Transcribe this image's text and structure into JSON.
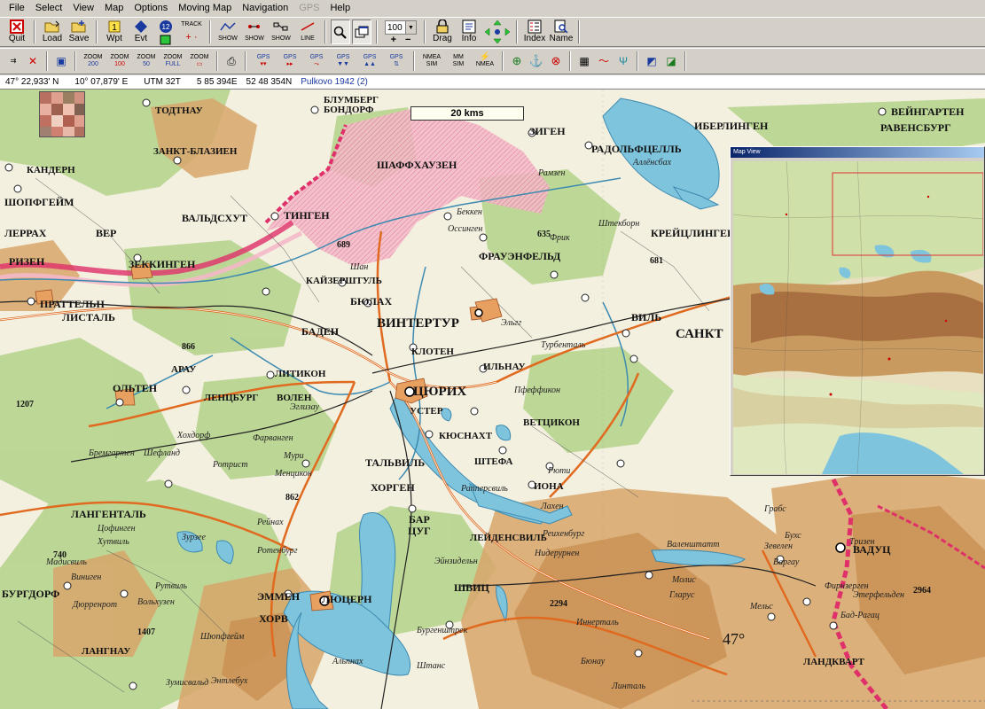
{
  "menu": {
    "items": [
      {
        "label": "File",
        "disabled": false
      },
      {
        "label": "Select",
        "disabled": false
      },
      {
        "label": "View",
        "disabled": false
      },
      {
        "label": "Map",
        "disabled": false
      },
      {
        "label": "Options",
        "disabled": false
      },
      {
        "label": "Moving Map",
        "disabled": false
      },
      {
        "label": "Navigation",
        "disabled": false
      },
      {
        "label": "GPS",
        "disabled": true
      },
      {
        "label": "Help",
        "disabled": false
      }
    ]
  },
  "toolbar": {
    "quit": "Quit",
    "load": "Load",
    "save": "Save",
    "wpt": "Wpt",
    "evt": "Evt",
    "badge": "12",
    "track": "TRACK",
    "show1": "SHOW",
    "show2": "SHOW",
    "show3": "SHOW",
    "line": "LINE",
    "zoom_value": "100",
    "zoom_plus": "+",
    "zoom_minus": "−",
    "drag": "Drag",
    "info": "Info",
    "index": "Index",
    "name": "Name"
  },
  "toolbar2": {
    "zoom200_a": "ZOOM",
    "zoom200_b": "200",
    "zoom100_a": "ZOOM",
    "zoom100_b": "100",
    "zoom50_a": "ZOOM",
    "zoom50_b": "50",
    "zoomfull_a": "ZOOM",
    "zoomfull_b": "FULL",
    "zoomx_a": "ZOOM",
    "gps1": "GPS",
    "gps2": "GPS",
    "gps3": "GPS",
    "gps4": "GPS",
    "gps5": "GPS",
    "gps6": "GPS",
    "nmea_a": "NMEA",
    "nmea_b": "SIM",
    "mm_a": "MM",
    "mm_b": "SIM",
    "nmea2": "NMEA"
  },
  "status": {
    "lat": "47° 22,933' N",
    "lon": "10° 07,879' E",
    "utm": "UTM 32T",
    "easting": "5 85 394E",
    "northing": "52 48 354N",
    "datum": "Pulkovo 1942 (2)"
  },
  "map": {
    "scale_label": "20 kms",
    "labels": [
      {
        "t": "ЗИГЕН"
      },
      {
        "t": "РАДОЛЬФЦЕЛЛЬ"
      },
      {
        "t": "ИБЕРЛИНГЕН"
      },
      {
        "t": "ВЕЙНГАРТЕН"
      },
      {
        "t": "РАВЕНСБУРГ"
      },
      {
        "t": "ШАФФХАУЗЕН"
      },
      {
        "t": "БЛУМБЕРГ"
      },
      {
        "t": "БОНДОРФ"
      },
      {
        "t": "ТОДТНАУ"
      },
      {
        "t": "КАНДЕРН"
      },
      {
        "t": "ШОПФГЕЙМ"
      },
      {
        "t": "ЛЕРРАХ"
      },
      {
        "t": "ВЕР"
      },
      {
        "t": "РИЗЕН"
      },
      {
        "t": "ВАЛЬДСХУТ"
      },
      {
        "t": "ТИНГЕН"
      },
      {
        "t": "ЗЕККИНГЕН"
      },
      {
        "t": "ПРАТТЕЛЬН"
      },
      {
        "t": "ЛИСТАЛЬ"
      },
      {
        "t": "КАЙЗЕРШТУЛЬ"
      },
      {
        "t": "БЮЛАХ"
      },
      {
        "t": "ВИНТЕРТУР"
      },
      {
        "t": "ФРАУЭНФЕЛЬД"
      },
      {
        "t": "ВИЛЬ"
      },
      {
        "t": "САНКТ"
      },
      {
        "t": "БАДЕН"
      },
      {
        "t": "КЛОТЕН"
      },
      {
        "t": "ИЛЬНАУ"
      },
      {
        "t": "ЛИТИКОН"
      },
      {
        "t": "ЛЕНЦБУРГ"
      },
      {
        "t": "ВОЛЕН"
      },
      {
        "t": "ЦЮРИХ"
      },
      {
        "t": "УСТЕР"
      },
      {
        "t": "ВЕТЦИКОН"
      },
      {
        "t": "КЮСНАХТ"
      },
      {
        "t": "ОЛЬТЕН"
      },
      {
        "t": "АРАУ"
      },
      {
        "t": "ТАЛЬВИЛЬ"
      },
      {
        "t": "ХОРГЕН"
      },
      {
        "t": "ШТЕФА"
      },
      {
        "t": "ИОНА"
      },
      {
        "t": "ЛАНГЕНТАЛЬ"
      },
      {
        "t": "БАР"
      },
      {
        "t": "ЦУГ"
      },
      {
        "t": "БУРГДОРФ"
      },
      {
        "t": "ЛЮЦЕРН"
      },
      {
        "t": "ЭММЕН"
      },
      {
        "t": "ХОРВ"
      },
      {
        "t": "ШВИЦ"
      },
      {
        "t": "ВАДУЦ"
      },
      {
        "t": "ЛАНГНАУ"
      },
      {
        "t": "ЛАНДКВАРТ"
      },
      {
        "t": "ЛЕЙДЕНСВИЛЬ"
      },
      {
        "t": "ЗАНКТ-БЛАЗИЕН"
      },
      {
        "t": "КРЕЙЦЛИНГЕН"
      }
    ],
    "small_labels": [
      {
        "t": "Штекборн"
      },
      {
        "t": "Аллёнсбах"
      },
      {
        "t": "Рамзен"
      },
      {
        "t": "Беккен"
      },
      {
        "t": "Оссинген"
      },
      {
        "t": "Фрик"
      },
      {
        "t": "Эльгг"
      },
      {
        "t": "Турбенталь"
      },
      {
        "t": "Пфеффикон"
      },
      {
        "t": "Фарвангeн"
      },
      {
        "t": "Мури"
      },
      {
        "t": "Менцикон"
      },
      {
        "t": "Рюти"
      },
      {
        "t": "Лахен"
      },
      {
        "t": "Рапперсвиль"
      },
      {
        "t": "Зурзее"
      },
      {
        "t": "Ротенбург"
      },
      {
        "t": "Вольхузен"
      },
      {
        "t": "Хутвиль"
      },
      {
        "t": "Рутвиль"
      },
      {
        "t": "Эйнзидельн"
      },
      {
        "t": "Реихенбург"
      },
      {
        "t": "Нидерурнен"
      },
      {
        "t": "Валенштатт"
      },
      {
        "t": "Грабс"
      },
      {
        "t": "Бухс"
      },
      {
        "t": "Зевелен"
      },
      {
        "t": "Варгау"
      },
      {
        "t": "Мельс"
      },
      {
        "t": "Бад-Рагац"
      },
      {
        "t": "Молис"
      },
      {
        "t": "Гларус"
      },
      {
        "t": "Линталь"
      },
      {
        "t": "Бюнау"
      },
      {
        "t": "Иннерталь"
      },
      {
        "t": "Фирнзерген"
      },
      {
        "t": "Этерфельден"
      },
      {
        "t": "Тризен"
      },
      {
        "t": "Шан"
      },
      {
        "t": "Эглизау"
      },
      {
        "t": "Бремгартен"
      },
      {
        "t": "Ротрист"
      },
      {
        "t": "Рейнах"
      },
      {
        "t": "Хохдорф"
      },
      {
        "t": "Шефланд"
      },
      {
        "t": "Цофинген"
      },
      {
        "t": "Мадисвиль"
      },
      {
        "t": "Виниген"
      },
      {
        "t": "Дюрренрот"
      },
      {
        "t": "Зумисвальд"
      },
      {
        "t": "Шюпфгейм"
      },
      {
        "t": "Энтлебух"
      },
      {
        "t": "Альпнах"
      },
      {
        "t": "Штанс"
      },
      {
        "t": "Бургенштрек"
      }
    ],
    "heights": [
      {
        "t": "689"
      },
      {
        "t": "635"
      },
      {
        "t": "681"
      },
      {
        "t": "866"
      },
      {
        "t": "862"
      },
      {
        "t": "740"
      },
      {
        "t": "1207"
      },
      {
        "t": "1407"
      },
      {
        "t": "2294"
      },
      {
        "t": "2964"
      },
      {
        "t": "47°"
      }
    ]
  },
  "mapview": {
    "title": "Map View"
  },
  "colors": {
    "water": "#7fc4dd",
    "forest": "#b7d48f",
    "relief": "#d7a66a",
    "road": "#e06a1f",
    "border": "#e0306a"
  }
}
